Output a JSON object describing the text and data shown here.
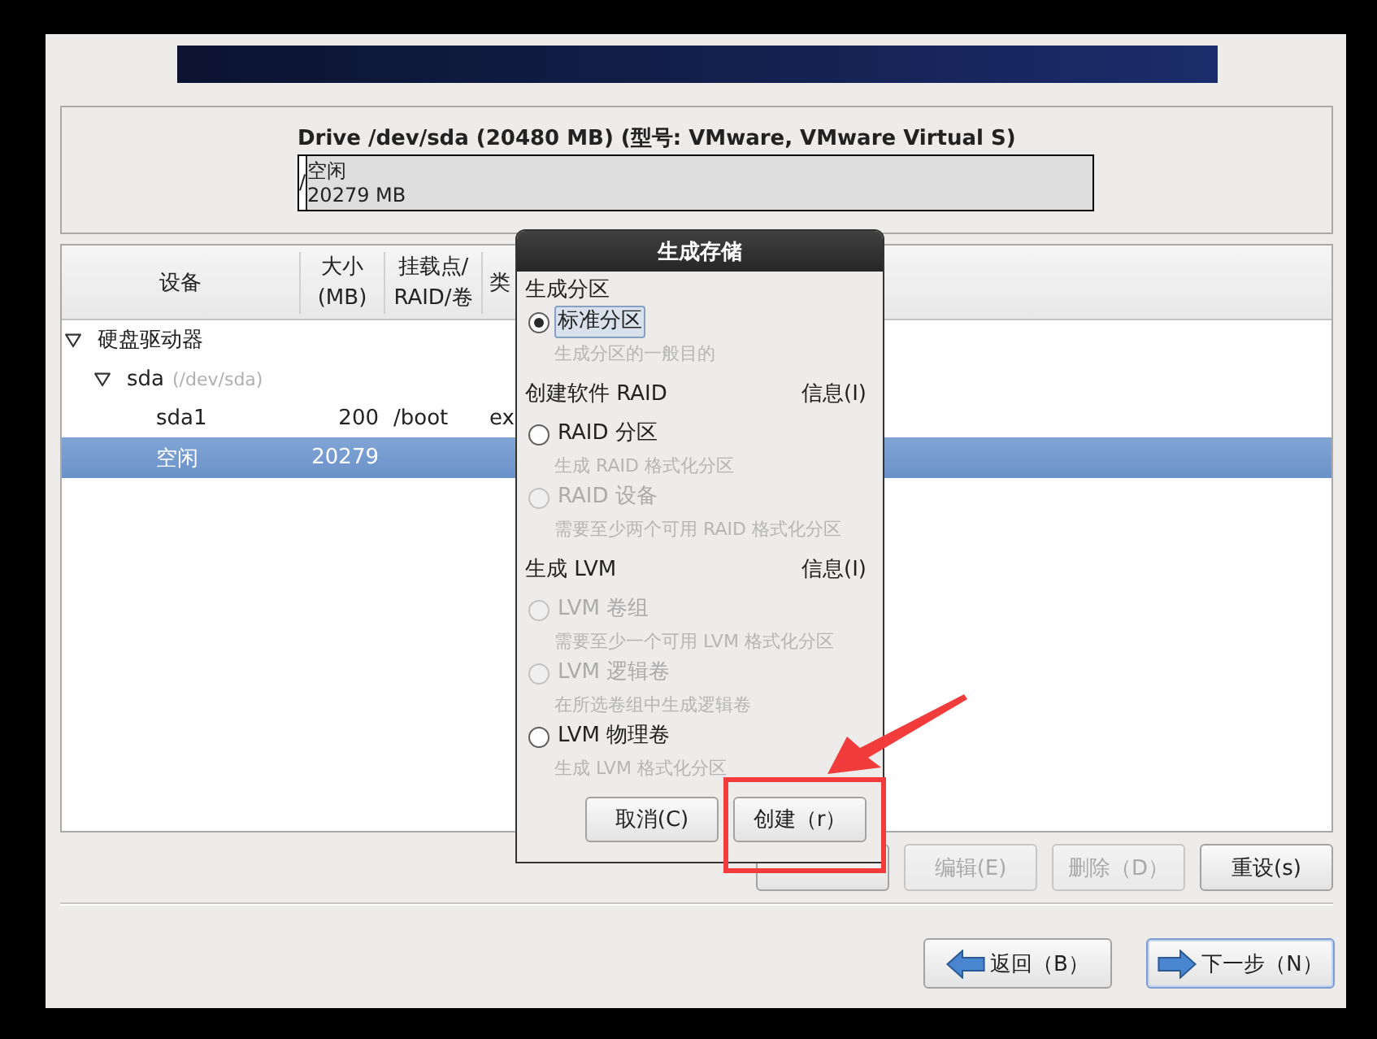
{
  "drive": {
    "title": "Drive /dev/sda (20480 MB) (型号: VMware, VMware Virtual S)",
    "segments": [
      {
        "kind": "partition",
        "label": "/",
        "level": 0.0098
      },
      {
        "kind": "free",
        "label": "空闲",
        "size": "20279 MB",
        "level": 0.9902
      }
    ]
  },
  "table": {
    "columns": [
      "设备",
      "大小\n(MB)",
      "挂载点/\nRAID/卷",
      "类"
    ],
    "rows": [
      {
        "name": "硬盘驱动器",
        "expanded": true,
        "selected": false,
        "children": [
          {
            "name": "sda",
            "detail": "(/dev/sda)",
            "expanded": true,
            "selected": false,
            "children": [
              {
                "name": "sda1",
                "size": "200",
                "mount": "/boot",
                "type": "ex",
                "selected": false
              },
              {
                "name": "空闲",
                "size": "20279",
                "selected": true
              }
            ]
          }
        ]
      }
    ]
  },
  "buttons": [
    {
      "disabled": false
    },
    {
      "label": "编辑(E)",
      "disabled": true
    },
    {
      "label": "删除（D）",
      "disabled": true
    },
    {
      "label": "重设(s)",
      "disabled": false
    }
  ],
  "navigation": [
    {
      "kind": "back",
      "label": "返回（B）",
      "focused": false
    },
    {
      "kind": "next",
      "label": "下一步（N）",
      "focused": true
    }
  ],
  "dialog": {
    "title": "生成存储",
    "sections": [
      {
        "title": "生成分区",
        "options": [
          {
            "label": "标准分区",
            "description": "生成分区的一般目的",
            "selected": true,
            "disabled": false,
            "focused": true
          }
        ]
      },
      {
        "title": "创建软件 RAID",
        "info": "信息(I)",
        "options": [
          {
            "label": "RAID 分区",
            "description": "生成 RAID 格式化分区",
            "selected": false,
            "disabled": false,
            "focused": false
          },
          {
            "label": "RAID 设备",
            "description": "需要至少两个可用 RAID 格式化分区",
            "selected": false,
            "disabled": true,
            "focused": false
          }
        ]
      },
      {
        "title": "生成 LVM",
        "info": "信息(I)",
        "options": [
          {
            "label": "LVM 卷组",
            "description": "需要至少一个可用 LVM 格式化分区",
            "selected": false,
            "disabled": true,
            "focused": false
          },
          {
            "label": "LVM 逻辑卷",
            "description": "在所选卷组中生成逻辑卷",
            "selected": false,
            "disabled": true,
            "focused": false
          },
          {
            "label": "LVM 物理卷",
            "description": "生成 LVM 格式化分区",
            "selected": false,
            "disabled": false,
            "focused": false
          }
        ]
      }
    ],
    "buttons": [
      {
        "label": "取消(C)"
      },
      {
        "label": "创建（r）"
      }
    ]
  },
  "annotations": {
    "frame": true,
    "arrow": true
  }
}
